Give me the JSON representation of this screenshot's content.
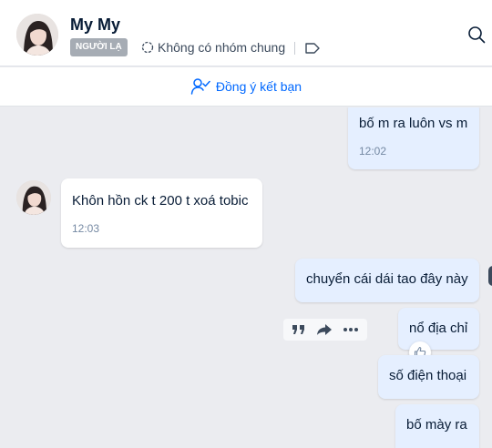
{
  "header": {
    "name": "My My",
    "badge": "NGƯỜI LẠ",
    "group_text": "Không có nhóm chung"
  },
  "friend_bar": {
    "label": "Đồng ý kết bạn"
  },
  "messages": [
    {
      "side": "me",
      "text": "bố m ra luôn vs m",
      "time": "12:02"
    },
    {
      "side": "them",
      "text": "Khôn hồn ck t 200 t xoá tobic",
      "time": "12:03"
    },
    {
      "side": "me",
      "text": "chuyển cái dái tao đây này"
    },
    {
      "side": "me",
      "text": "nổ địa chỉ"
    },
    {
      "side": "me",
      "text": "số điện thoại"
    },
    {
      "side": "me",
      "text": "bố mày ra"
    }
  ],
  "icons": {
    "search": "search-icon",
    "group": "group-circle-icon",
    "tag": "tag-icon",
    "add_friend": "user-check-icon",
    "quote": "quote-icon",
    "forward": "forward-icon",
    "more": "more-icon",
    "like": "thumbs-up-icon"
  },
  "colors": {
    "accent": "#0068ff",
    "my_bubble": "#e5efff",
    "their_bubble": "#ffffff",
    "chat_bg": "#ebecf0",
    "time": "#7589a3"
  }
}
